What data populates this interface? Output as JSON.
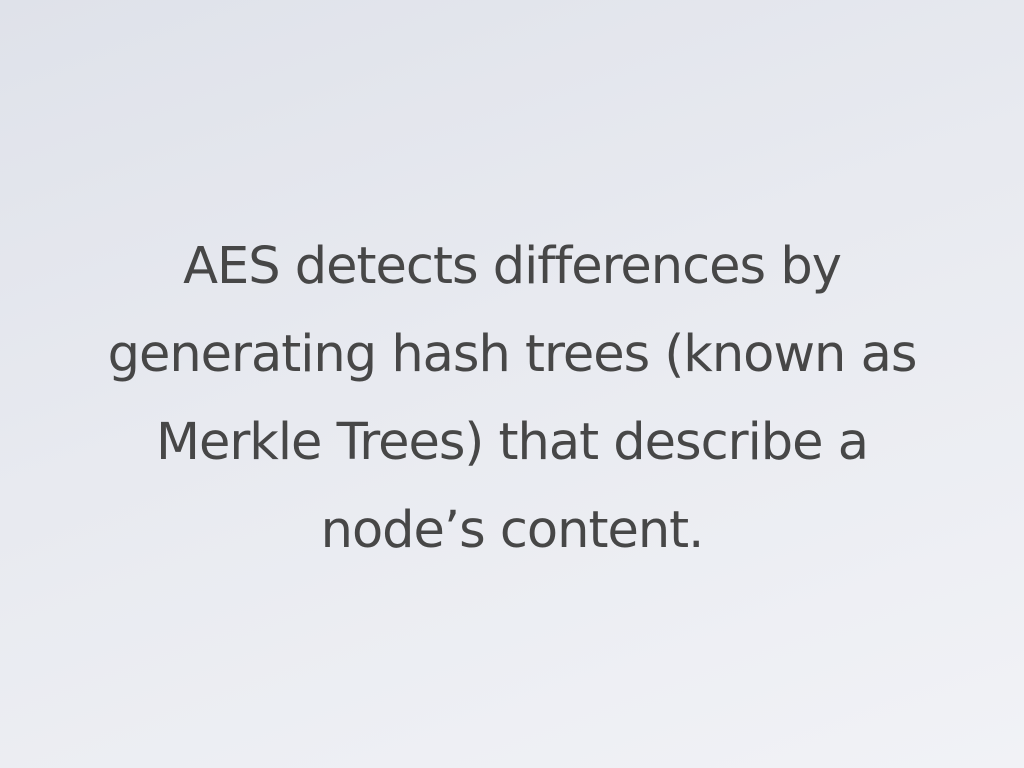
{
  "slide": {
    "lines": [
      "AES detects differences by",
      "generating hash trees (known as",
      "Merkle Trees) that describe a",
      "node’s content."
    ]
  }
}
